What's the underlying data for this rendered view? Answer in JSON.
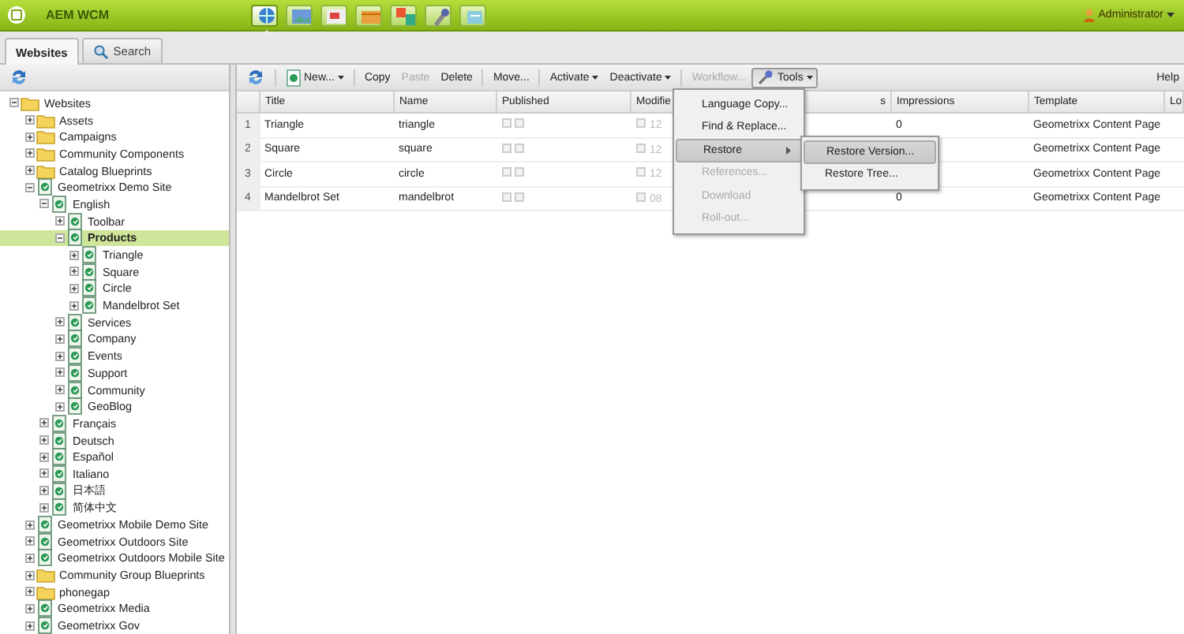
{
  "header": {
    "title": "AEM WCM",
    "user": "Administrator",
    "nav_icons": [
      {
        "selected": true
      },
      {
        "selected": false
      },
      {
        "selected": false
      },
      {
        "selected": false
      },
      {
        "selected": false
      },
      {
        "selected": false
      },
      {
        "selected": false
      }
    ]
  },
  "tabs": [
    {
      "label": "Websites",
      "selected": true
    },
    {
      "label": "Search",
      "selected": false
    }
  ],
  "tree": [
    {
      "label": "Websites",
      "kind": "folder",
      "expanded": true,
      "selected": false,
      "children": [
        {
          "label": "Assets",
          "kind": "folder",
          "expanded": false,
          "selected": false
        },
        {
          "label": "Campaigns",
          "kind": "folder",
          "expanded": false,
          "selected": false
        },
        {
          "label": "Community Components",
          "kind": "folder",
          "expanded": false,
          "selected": false
        },
        {
          "label": "Catalog Blueprints",
          "kind": "folder",
          "expanded": false,
          "selected": false
        },
        {
          "label": "Geometrixx Demo Site",
          "kind": "page",
          "expanded": true,
          "selected": false,
          "children": [
            {
              "label": "English",
              "kind": "page",
              "expanded": true,
              "selected": false,
              "children": [
                {
                  "label": "Toolbar",
                  "kind": "page",
                  "expanded": false,
                  "selected": false
                },
                {
                  "label": "Products",
                  "kind": "page",
                  "expanded": true,
                  "selected": true,
                  "children": [
                    {
                      "label": "Triangle",
                      "kind": "page",
                      "expanded": false,
                      "selected": false
                    },
                    {
                      "label": "Square",
                      "kind": "page",
                      "expanded": false,
                      "selected": false
                    },
                    {
                      "label": "Circle",
                      "kind": "page",
                      "expanded": false,
                      "selected": false
                    },
                    {
                      "label": "Mandelbrot Set",
                      "kind": "page",
                      "expanded": false,
                      "selected": false
                    }
                  ]
                },
                {
                  "label": "Services",
                  "kind": "page",
                  "expanded": false,
                  "selected": false
                },
                {
                  "label": "Company",
                  "kind": "page",
                  "expanded": false,
                  "selected": false
                },
                {
                  "label": "Events",
                  "kind": "page",
                  "expanded": false,
                  "selected": false
                },
                {
                  "label": "Support",
                  "kind": "page",
                  "expanded": false,
                  "selected": false
                },
                {
                  "label": "Community",
                  "kind": "page",
                  "expanded": false,
                  "selected": false
                },
                {
                  "label": "GeoBlog",
                  "kind": "page",
                  "expanded": false,
                  "selected": false
                }
              ]
            },
            {
              "label": "Français",
              "kind": "page",
              "expanded": false,
              "selected": false
            },
            {
              "label": "Deutsch",
              "kind": "page",
              "expanded": false,
              "selected": false
            },
            {
              "label": "Español",
              "kind": "page",
              "expanded": false,
              "selected": false
            },
            {
              "label": "Italiano",
              "kind": "page",
              "expanded": false,
              "selected": false
            },
            {
              "label": "日本語",
              "kind": "page",
              "expanded": false,
              "selected": false
            },
            {
              "label": "简体中文",
              "kind": "page",
              "expanded": false,
              "selected": false
            }
          ]
        },
        {
          "label": "Geometrixx Mobile Demo Site",
          "kind": "page",
          "expanded": false,
          "selected": false
        },
        {
          "label": "Geometrixx Outdoors Site",
          "kind": "page",
          "expanded": false,
          "selected": false
        },
        {
          "label": "Geometrixx Outdoors Mobile Site",
          "kind": "page",
          "expanded": false,
          "selected": false
        },
        {
          "label": "Community Group Blueprints",
          "kind": "folder",
          "expanded": false,
          "selected": false
        },
        {
          "label": "phonegap",
          "kind": "folder",
          "expanded": false,
          "selected": false
        },
        {
          "label": "Geometrixx Media",
          "kind": "page",
          "expanded": false,
          "selected": false
        },
        {
          "label": "Geometrixx Gov",
          "kind": "page",
          "expanded": false,
          "selected": false
        }
      ]
    }
  ],
  "toolbar": [
    {
      "kind": "refresh"
    },
    {
      "kind": "button",
      "label": "New...",
      "icon": true,
      "dropdown": true,
      "disabled": false,
      "pressed": false
    },
    {
      "kind": "separator"
    },
    {
      "kind": "button",
      "label": "Copy",
      "icon": false,
      "dropdown": false,
      "disabled": false,
      "pressed": false
    },
    {
      "kind": "button",
      "label": "Paste",
      "icon": false,
      "dropdown": false,
      "disabled": true,
      "pressed": false
    },
    {
      "kind": "button",
      "label": "Delete",
      "icon": false,
      "dropdown": false,
      "disabled": false,
      "pressed": false
    },
    {
      "kind": "separator"
    },
    {
      "kind": "button",
      "label": "Move...",
      "icon": false,
      "dropdown": false,
      "disabled": false,
      "pressed": false
    },
    {
      "kind": "separator"
    },
    {
      "kind": "button",
      "label": "Activate",
      "icon": false,
      "dropdown": true,
      "disabled": false,
      "pressed": false
    },
    {
      "kind": "button",
      "label": "Deactivate",
      "icon": false,
      "dropdown": true,
      "disabled": false,
      "pressed": false
    },
    {
      "kind": "separator"
    },
    {
      "kind": "button",
      "label": "Workflow...",
      "icon": false,
      "dropdown": false,
      "disabled": true,
      "pressed": false
    },
    {
      "kind": "button",
      "label": "Tools",
      "icon": true,
      "dropdown": true,
      "disabled": false,
      "pressed": true
    },
    {
      "kind": "spacer"
    },
    {
      "kind": "button",
      "label": "Help",
      "icon": false,
      "dropdown": false,
      "disabled": false,
      "pressed": false
    }
  ],
  "table": {
    "columns": [
      "Title",
      "Name",
      "Published",
      "Modifie",
      "s",
      "Impressions",
      "Template",
      "Lo"
    ],
    "rows": [
      {
        "number": "1",
        "title": "Triangle",
        "name": "triangle",
        "modified": "12",
        "impressions": "0",
        "template": "Geometrixx Content Page"
      },
      {
        "number": "2",
        "title": "Square",
        "name": "square",
        "modified": "12",
        "impressions": "",
        "template": "Geometrixx Content Page"
      },
      {
        "number": "3",
        "title": "Circle",
        "name": "circle",
        "modified": "12",
        "impressions": "",
        "template": "Geometrixx Content Page"
      },
      {
        "number": "4",
        "title": "Mandelbrot Set",
        "name": "mandelbrot",
        "modified": "08",
        "impressions": "0",
        "template": "Geometrixx Content Page"
      }
    ]
  },
  "tools_menu": [
    {
      "label": "Language Copy...",
      "disabled": false,
      "selected": false,
      "submenu": false
    },
    {
      "label": "Find & Replace...",
      "disabled": false,
      "selected": false,
      "submenu": false
    },
    {
      "label": "Restore",
      "disabled": false,
      "selected": true,
      "submenu": true
    },
    {
      "label": "References...",
      "disabled": true,
      "selected": false,
      "submenu": false
    },
    {
      "label": "Download",
      "disabled": true,
      "selected": false,
      "submenu": false
    },
    {
      "label": "Roll-out...",
      "disabled": true,
      "selected": false,
      "submenu": false
    }
  ],
  "restore_submenu": [
    {
      "label": "Restore Version...",
      "selected": true
    },
    {
      "label": "Restore Tree...",
      "selected": false
    }
  ]
}
